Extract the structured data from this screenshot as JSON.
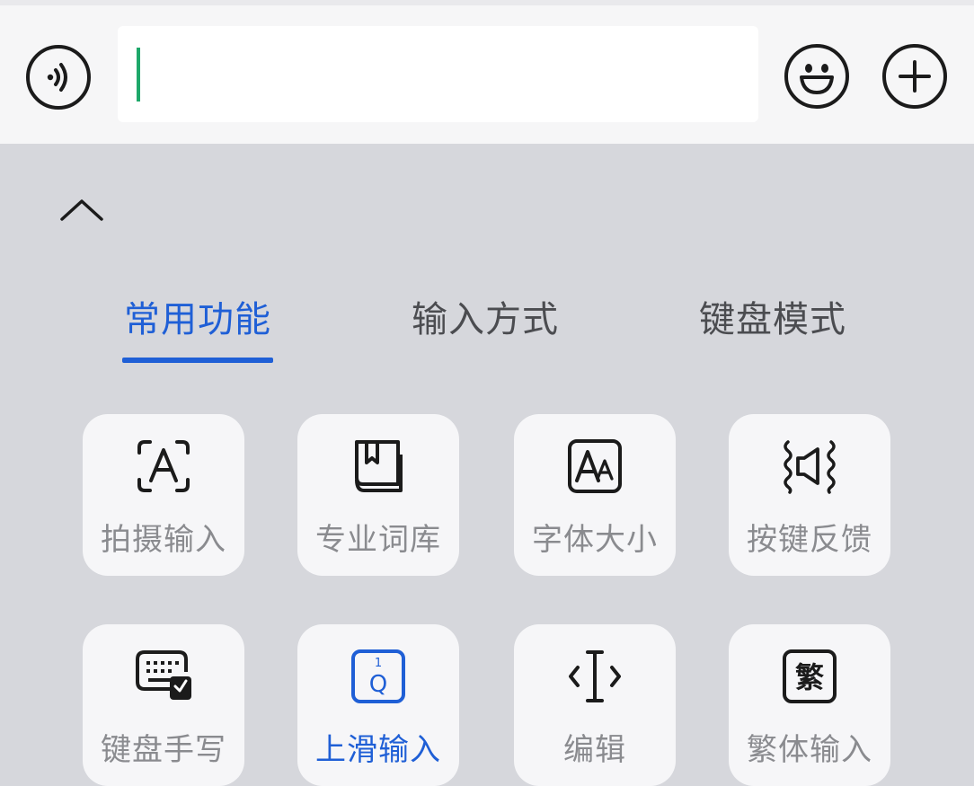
{
  "toolbar": {
    "voice_icon": "voice-input-icon",
    "emoji_icon": "emoji-icon",
    "plus_icon": "plus-icon",
    "input_value": ""
  },
  "panel": {
    "collapse_icon": "chevron-up-icon",
    "tabs": [
      {
        "label": "常用功能",
        "active": true
      },
      {
        "label": "输入方式",
        "active": false
      },
      {
        "label": "键盘模式",
        "active": false
      }
    ],
    "tiles": [
      {
        "label": "拍摄输入",
        "icon": "camera-scan-icon"
      },
      {
        "label": "专业词库",
        "icon": "dictionary-book-icon"
      },
      {
        "label": "字体大小",
        "icon": "font-size-icon"
      },
      {
        "label": "按键反馈",
        "icon": "key-vibration-icon"
      },
      {
        "label": "键盘手写",
        "icon": "keyboard-handwrite-icon"
      },
      {
        "label": "上滑输入",
        "icon": "swipe-up-input-icon",
        "active": true
      },
      {
        "label": "编辑",
        "icon": "edit-cursor-icon"
      },
      {
        "label": "繁体输入",
        "icon": "traditional-chinese-icon",
        "glyph": "繁"
      }
    ],
    "swipe_icon_digit": "1",
    "swipe_icon_letter": "Q"
  },
  "colors": {
    "accent": "#1f5fd6",
    "caret": "#1ea86a",
    "panel_bg": "#d6d7dc",
    "tile_bg": "#f6f6f8"
  }
}
